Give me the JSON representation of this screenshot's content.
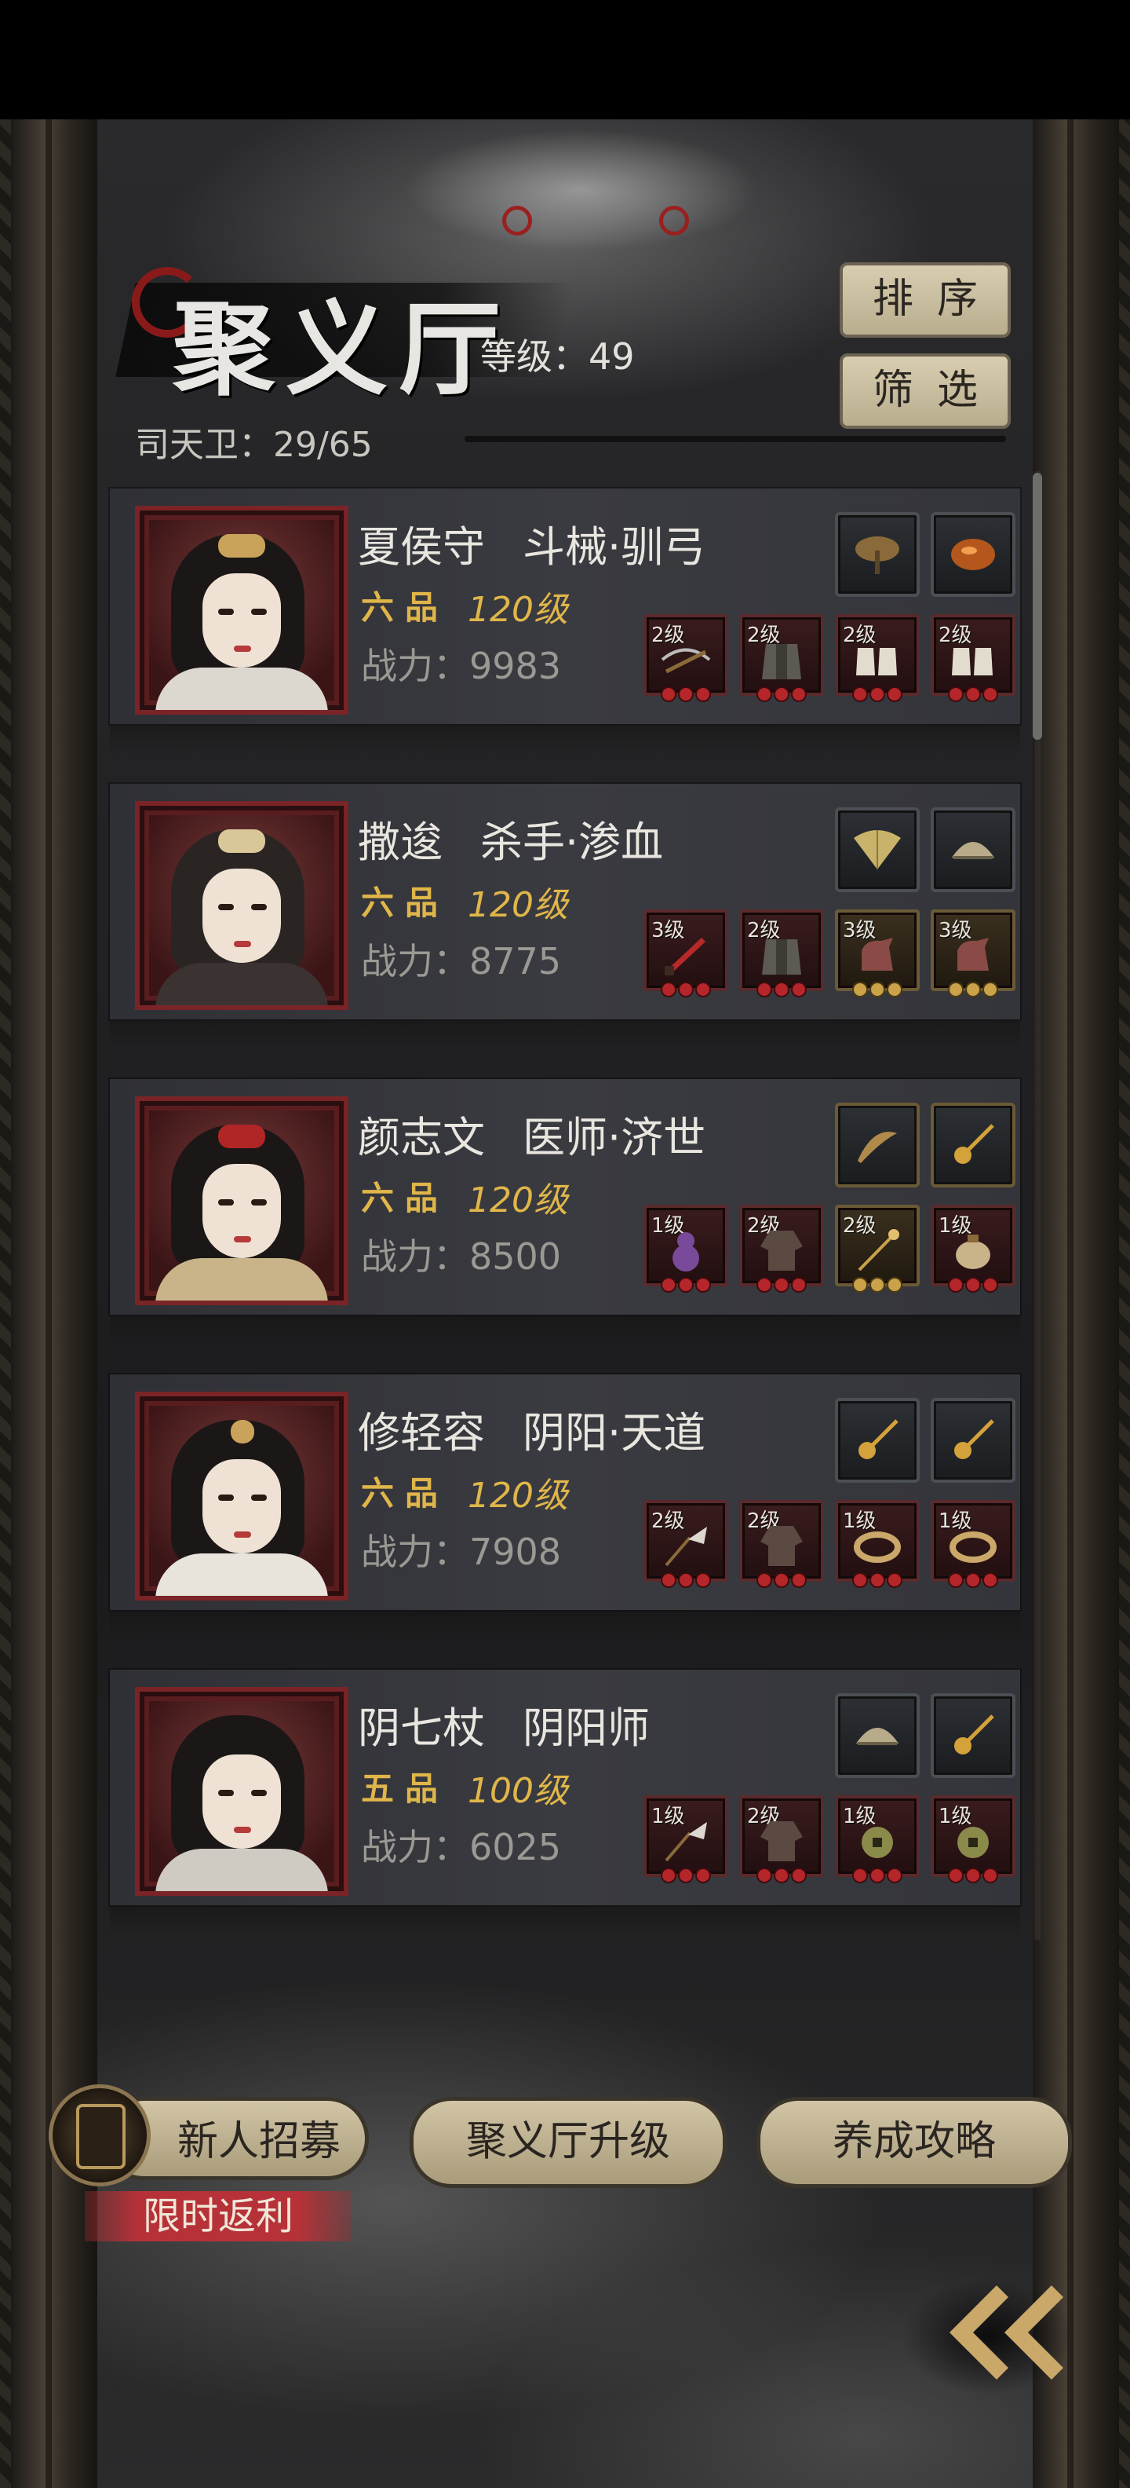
{
  "header": {
    "title": "聚义厅",
    "level_text": "等级：49",
    "member_count": "司天卫：29/65",
    "sort_button": "排序",
    "filter_button": "筛选"
  },
  "heroes": [
    {
      "name": "夏侯守",
      "role": "斗械·驯弓",
      "rank": "六品",
      "level": "120级",
      "power": "战力：9983",
      "treasures": [
        "lingzhi-mushroom-icon",
        "amber-gem-icon"
      ],
      "equipment": [
        {
          "grade": "2级",
          "icon": "crossbow-icon",
          "stars": 3,
          "star_color": "red"
        },
        {
          "grade": "2级",
          "icon": "armor-icon",
          "stars": 3,
          "star_color": "red"
        },
        {
          "grade": "2级",
          "icon": "boots-icon",
          "stars": 3,
          "star_color": "red"
        },
        {
          "grade": "2级",
          "icon": "boots-icon",
          "stars": 3,
          "star_color": "red"
        }
      ]
    },
    {
      "name": "撒逡",
      "role": "杀手·渗血",
      "rank": "六品",
      "level": "120级",
      "power": "战力：8775",
      "treasures": [
        "fan-icon",
        "comb-icon"
      ],
      "equipment": [
        {
          "grade": "3级",
          "icon": "dagger-icon",
          "stars": 3,
          "star_color": "red"
        },
        {
          "grade": "2级",
          "icon": "armor-icon",
          "stars": 3,
          "star_color": "red"
        },
        {
          "grade": "3级",
          "icon": "horse-icon",
          "stars": 3,
          "star_color": "gold"
        },
        {
          "grade": "3级",
          "icon": "horse-icon",
          "stars": 3,
          "star_color": "gold"
        }
      ]
    },
    {
      "name": "颜志文",
      "role": "医师·济世",
      "rank": "六品",
      "level": "120级",
      "power": "战力：8500",
      "treasures": [
        "hairpin-icon",
        "golden-hairpin-icon"
      ],
      "equipment": [
        {
          "grade": "1级",
          "icon": "gourd-icon",
          "stars": 3,
          "star_color": "red"
        },
        {
          "grade": "2级",
          "icon": "robe-icon",
          "stars": 3,
          "star_color": "red"
        },
        {
          "grade": "2级",
          "icon": "staff-icon",
          "stars": 3,
          "star_color": "gold"
        },
        {
          "grade": "1级",
          "icon": "pouch-icon",
          "stars": 3,
          "star_color": "red"
        }
      ]
    },
    {
      "name": "修轻容",
      "role": "阴阳·天道",
      "rank": "六品",
      "level": "120级",
      "power": "战力：7908",
      "treasures": [
        "golden-hairpin-icon",
        "golden-hairpin-icon"
      ],
      "equipment": [
        {
          "grade": "2级",
          "icon": "whisk-icon",
          "stars": 3,
          "star_color": "red"
        },
        {
          "grade": "2级",
          "icon": "robe-icon",
          "stars": 3,
          "star_color": "red"
        },
        {
          "grade": "1级",
          "icon": "bracelet-icon",
          "stars": 3,
          "star_color": "red"
        },
        {
          "grade": "1级",
          "icon": "bracelet-icon",
          "stars": 3,
          "star_color": "red"
        }
      ]
    },
    {
      "name": "阴七杖",
      "role": "阴阳师",
      "rank": "五品",
      "level": "100级",
      "power": "战力：6025",
      "treasures": [
        "comb-icon",
        "golden-hairpin-icon"
      ],
      "equipment": [
        {
          "grade": "1级",
          "icon": "whisk-icon",
          "stars": 3,
          "star_color": "red"
        },
        {
          "grade": "2级",
          "icon": "robe-icon",
          "stars": 3,
          "star_color": "red"
        },
        {
          "grade": "1级",
          "icon": "coin-icon",
          "stars": 3,
          "star_color": "red"
        },
        {
          "grade": "1级",
          "icon": "coin-icon",
          "stars": 3,
          "star_color": "red"
        }
      ]
    }
  ],
  "footer": {
    "recruit_button": "新人招募",
    "upgrade_button": "聚义厅升级",
    "guide_button": "养成攻略",
    "promo_label": "限时返利",
    "back_icon": "double-chevron-left-icon"
  },
  "colors": {
    "rank_gold": "#e0b64a",
    "button_beige": "#d1c5a6",
    "promo_red": "#b63238",
    "portrait_frame": "#7a2427"
  }
}
